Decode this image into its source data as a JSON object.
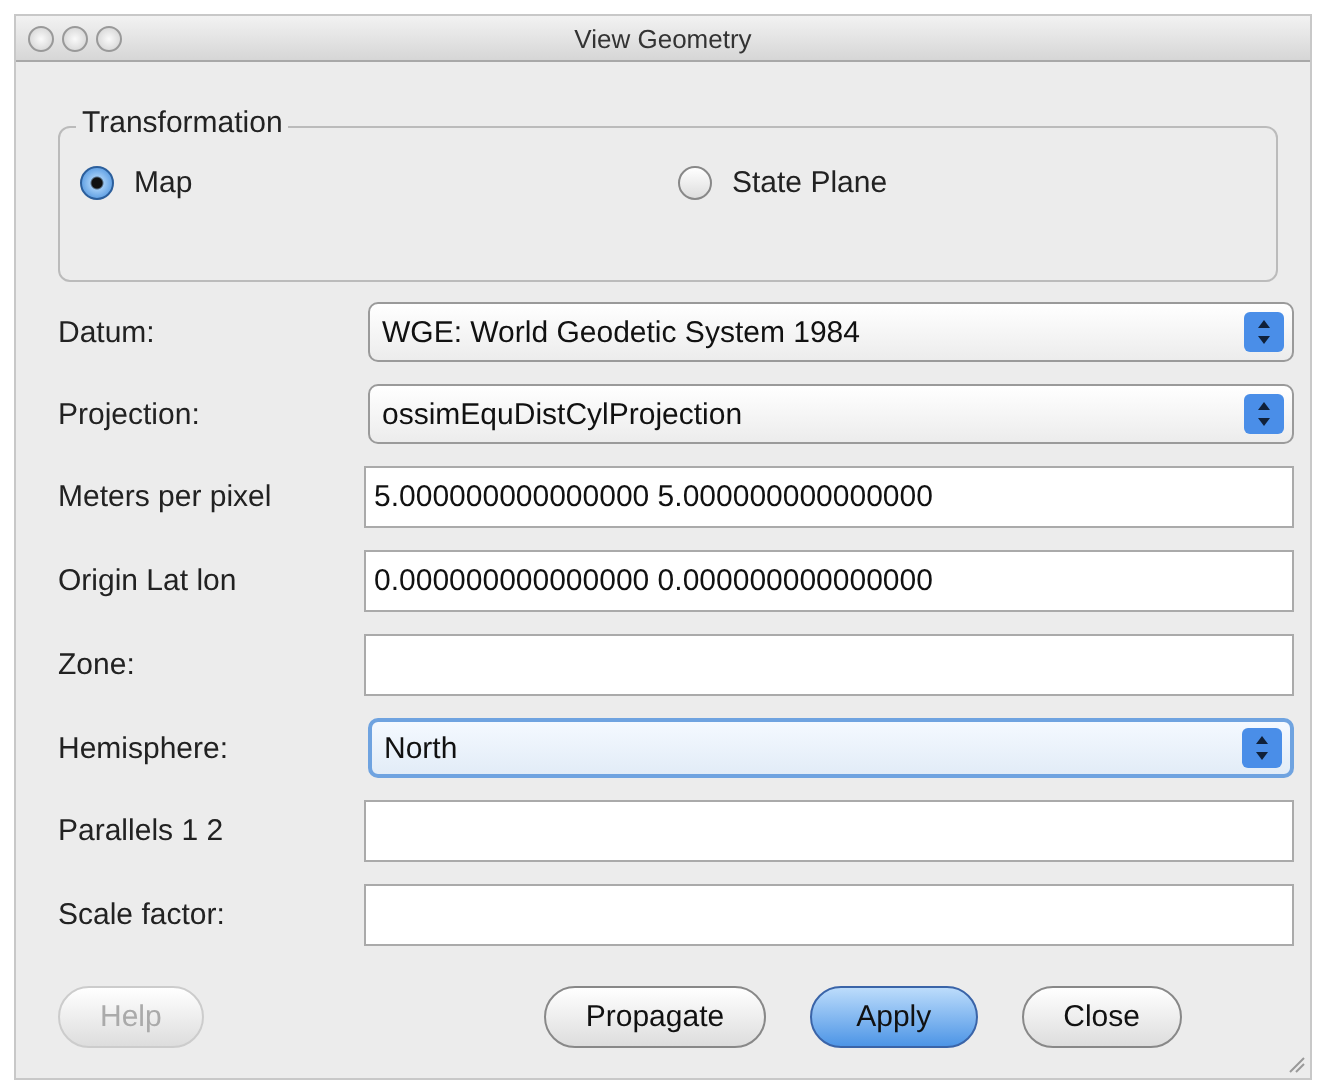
{
  "window": {
    "title": "View Geometry"
  },
  "transformation": {
    "title": "Transformation",
    "options": [
      {
        "label": "Map",
        "selected": true
      },
      {
        "label": "State Plane",
        "selected": false
      }
    ]
  },
  "fields": [
    {
      "label": "Datum:",
      "kind": "select",
      "value": "WGE: World Geodetic System 1984",
      "focused": false
    },
    {
      "label": "Projection:",
      "kind": "select",
      "value": "ossimEquDistCylProjection",
      "focused": false
    },
    {
      "label": "Meters per pixel",
      "kind": "text",
      "value": "5.000000000000000 5.000000000000000"
    },
    {
      "label": "Origin Lat lon",
      "kind": "text",
      "value": "0.000000000000000 0.000000000000000"
    },
    {
      "label": "Zone:",
      "kind": "text"
    },
    {
      "label": "Hemisphere:",
      "kind": "select",
      "value": "North",
      "focused": true
    },
    {
      "label": "Parallels 1  2",
      "kind": "text"
    },
    {
      "label": "Scale factor:",
      "kind": "text"
    }
  ],
  "buttons": [
    {
      "label": "Help",
      "disabled": true,
      "default": false
    },
    {
      "label": "Propagate",
      "disabled": false,
      "default": false
    },
    {
      "label": "Apply",
      "disabled": false,
      "default": true
    },
    {
      "label": "Close",
      "disabled": false,
      "default": false
    }
  ]
}
